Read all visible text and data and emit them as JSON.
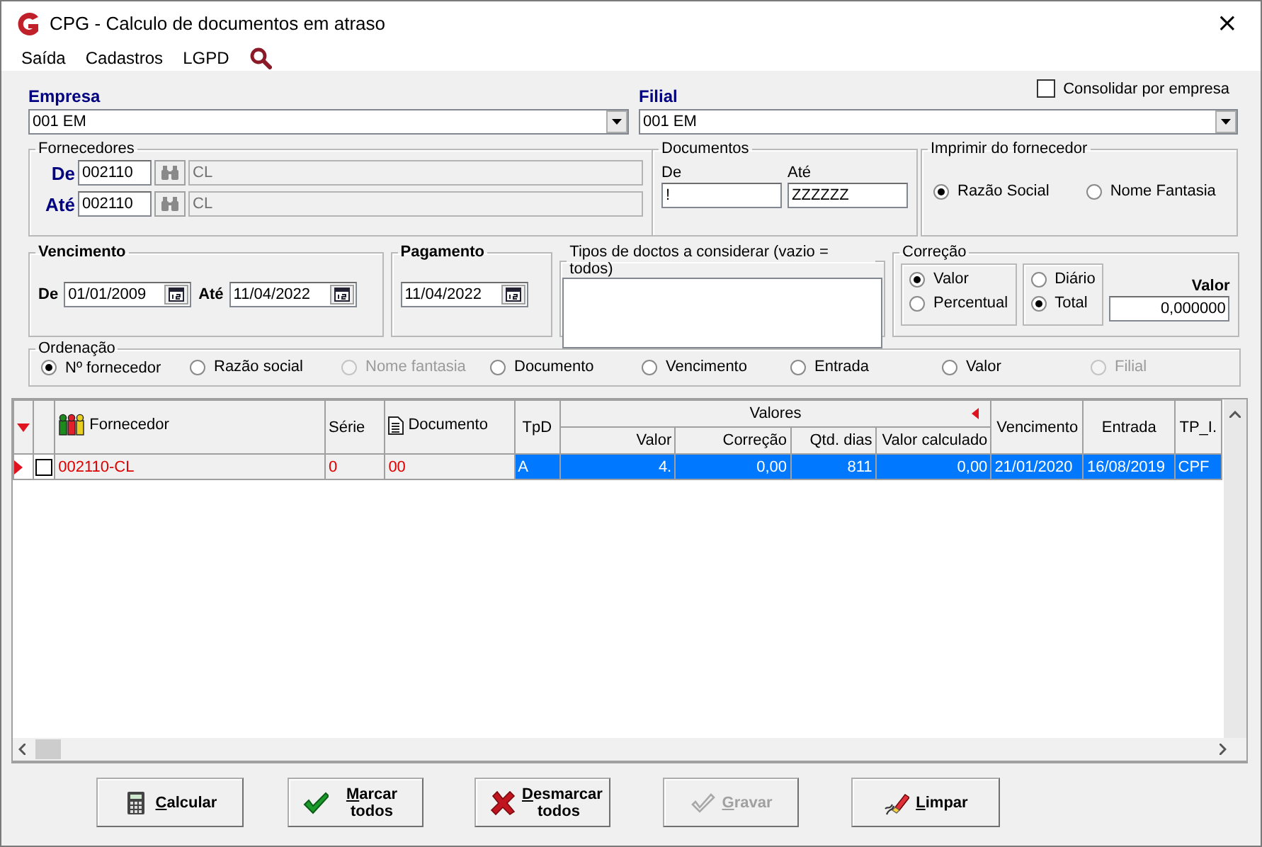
{
  "window": {
    "title": "CPG - Calculo de documentos em atraso",
    "close": "×"
  },
  "menu": [
    {
      "label": "Saída"
    },
    {
      "label": "Cadastros"
    },
    {
      "label": "LGPD"
    }
  ],
  "empresa": {
    "label": "Empresa",
    "value": "001 EM"
  },
  "filial": {
    "label": "Filial",
    "value": "001 EM"
  },
  "consolidar": {
    "label": "Consolidar por empresa",
    "checked": false
  },
  "fornecedores": {
    "title": "Fornecedores",
    "rows": [
      {
        "label": "De",
        "code": "002110",
        "name": "CL"
      },
      {
        "label": "Até",
        "code": "002110",
        "name": "CL"
      }
    ]
  },
  "documentos": {
    "title": "Documentos",
    "fields": [
      {
        "label": "De",
        "value": "!"
      },
      {
        "label": "Até",
        "value": "ZZZZZZ"
      }
    ]
  },
  "imprimir": {
    "title": "Imprimir do fornecedor",
    "options": [
      {
        "label": "Razão Social",
        "selected": true
      },
      {
        "label": "Nome Fantasia",
        "selected": false
      }
    ]
  },
  "vencimento": {
    "title": "Vencimento",
    "from_label": "De",
    "from": "01/01/2009",
    "to_label": "Até",
    "to": "11/04/2022"
  },
  "pagamento": {
    "title": "Pagamento",
    "date": "11/04/2022"
  },
  "tipos": {
    "title": "Tipos de doctos a considerar (vazio = todos)"
  },
  "correcao": {
    "title": "Correção",
    "mode": [
      {
        "label": "Valor",
        "selected": true
      },
      {
        "label": "Percentual",
        "selected": false
      }
    ],
    "period": [
      {
        "label": "Diário",
        "selected": false
      },
      {
        "label": "Total",
        "selected": true
      }
    ],
    "valor_label": "Valor",
    "valor": "0,000000"
  },
  "ordenacao": {
    "title": "Ordenação",
    "options": [
      {
        "label": "Nº fornecedor",
        "selected": true,
        "disabled": false
      },
      {
        "label": "Razão social",
        "selected": false,
        "disabled": false
      },
      {
        "label": "Nome fantasia",
        "selected": false,
        "disabled": true
      },
      {
        "label": "Documento",
        "selected": false,
        "disabled": false
      },
      {
        "label": "Vencimento",
        "selected": false,
        "disabled": false
      },
      {
        "label": "Entrada",
        "selected": false,
        "disabled": false
      },
      {
        "label": "Valor",
        "selected": false,
        "disabled": false
      },
      {
        "label": "Filial",
        "selected": false,
        "disabled": true
      }
    ]
  },
  "table": {
    "group_header": "Valores",
    "columns": [
      {
        "label": "Fornecedor",
        "group": false
      },
      {
        "label": "Série",
        "group": false
      },
      {
        "label": "Documento",
        "group": false
      },
      {
        "label": "TpD",
        "group": false
      },
      {
        "label": "Valor",
        "group": true
      },
      {
        "label": "Correção",
        "group": true
      },
      {
        "label": "Qtd. dias",
        "group": true
      },
      {
        "label": "Valor calculado",
        "group": true
      },
      {
        "label": "Vencimento",
        "group": false
      },
      {
        "label": "Entrada",
        "group": false
      },
      {
        "label": "TP_I.",
        "group": false
      }
    ],
    "rows": [
      {
        "selected": true,
        "checked": false,
        "cells": [
          "002110-CL",
          "0",
          "00",
          "A",
          "4.",
          "0,00",
          "811",
          "0,00",
          "21/01/2020",
          "16/08/2019",
          "CPF"
        ]
      }
    ]
  },
  "buttons": [
    {
      "label": "Calcular",
      "disabled": false
    },
    {
      "label": "Marcar todos",
      "disabled": false
    },
    {
      "label": "Desmarcar todos",
      "disabled": false
    },
    {
      "label": "Gravar",
      "disabled": true
    },
    {
      "label": "Limpar",
      "disabled": false
    }
  ]
}
